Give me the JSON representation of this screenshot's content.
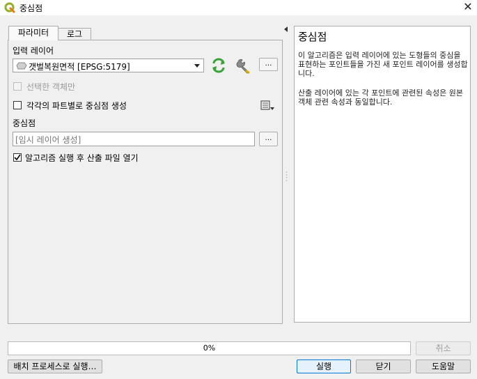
{
  "window": {
    "title": "중심점",
    "close_glyph": "✕",
    "icon": "qgis-logo-icon"
  },
  "tabs": [
    {
      "label": "파라미터",
      "active": true
    },
    {
      "label": "로그",
      "active": false
    }
  ],
  "params": {
    "input_layer_label": "입력 레이어",
    "input_layer_value": "갯벌복원면적 [EPSG:5179]",
    "more_button": "…",
    "selected_only_label": "선택한 객체만",
    "selected_only_checked": false,
    "selected_only_enabled": false,
    "per_part_label": "각각의 파트별로 중심점 생성",
    "per_part_checked": false,
    "output_label": "중심점",
    "output_placeholder": "[임시 레이어 생성]",
    "open_after_label": "알고리즘 실행 후 산출 파일 열기",
    "open_after_checked": true
  },
  "help": {
    "title": "중심점",
    "paragraph1": "이 알고리즘은 입력 레이어에 있는 도형들의 중심을 표현하는 포인트들을 가진 새 포인트 레이어를 생성합니다.",
    "paragraph2": "산출 레이어에 있는 각 포인트에 관련된 속성은 원본 객체 관련 속성과 동일합니다."
  },
  "progress": {
    "value_text": "0%",
    "value": 0
  },
  "buttons": {
    "cancel": "취소",
    "batch": "배치 프로세스로 실행…",
    "run": "실행",
    "close": "닫기",
    "help": "도움말"
  },
  "colors": {
    "accent": "#0078d7",
    "iterate_icon": "#3aa33a",
    "qgis_green": "#93b023"
  }
}
